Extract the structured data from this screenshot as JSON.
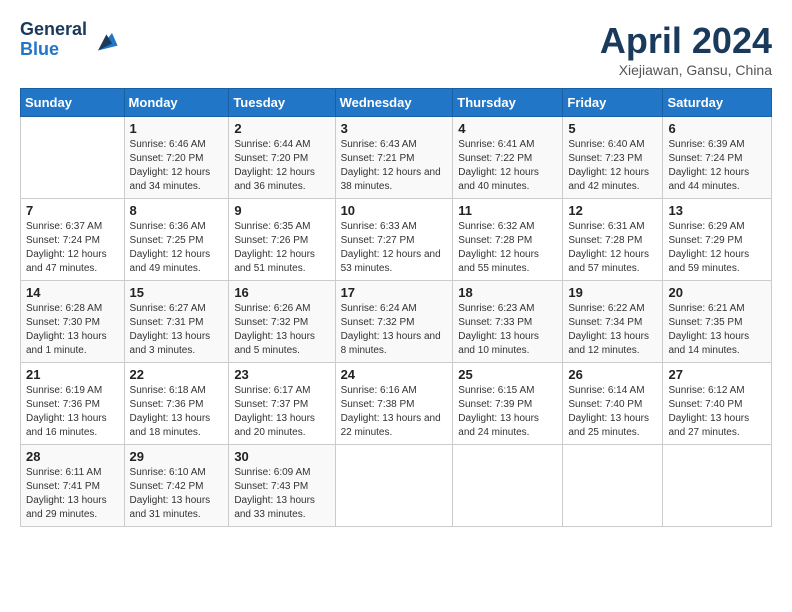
{
  "header": {
    "logo_general": "General",
    "logo_blue": "Blue",
    "title": "April 2024",
    "subtitle": "Xiejiawan, Gansu, China"
  },
  "weekdays": [
    "Sunday",
    "Monday",
    "Tuesday",
    "Wednesday",
    "Thursday",
    "Friday",
    "Saturday"
  ],
  "weeks": [
    [
      {
        "day": "",
        "sunrise": "",
        "sunset": "",
        "daylight": ""
      },
      {
        "day": "1",
        "sunrise": "6:46 AM",
        "sunset": "7:20 PM",
        "daylight": "12 hours and 34 minutes."
      },
      {
        "day": "2",
        "sunrise": "6:44 AM",
        "sunset": "7:20 PM",
        "daylight": "12 hours and 36 minutes."
      },
      {
        "day": "3",
        "sunrise": "6:43 AM",
        "sunset": "7:21 PM",
        "daylight": "12 hours and 38 minutes."
      },
      {
        "day": "4",
        "sunrise": "6:41 AM",
        "sunset": "7:22 PM",
        "daylight": "12 hours and 40 minutes."
      },
      {
        "day": "5",
        "sunrise": "6:40 AM",
        "sunset": "7:23 PM",
        "daylight": "12 hours and 42 minutes."
      },
      {
        "day": "6",
        "sunrise": "6:39 AM",
        "sunset": "7:24 PM",
        "daylight": "12 hours and 44 minutes."
      }
    ],
    [
      {
        "day": "7",
        "sunrise": "6:37 AM",
        "sunset": "7:24 PM",
        "daylight": "12 hours and 47 minutes."
      },
      {
        "day": "8",
        "sunrise": "6:36 AM",
        "sunset": "7:25 PM",
        "daylight": "12 hours and 49 minutes."
      },
      {
        "day": "9",
        "sunrise": "6:35 AM",
        "sunset": "7:26 PM",
        "daylight": "12 hours and 51 minutes."
      },
      {
        "day": "10",
        "sunrise": "6:33 AM",
        "sunset": "7:27 PM",
        "daylight": "12 hours and 53 minutes."
      },
      {
        "day": "11",
        "sunrise": "6:32 AM",
        "sunset": "7:28 PM",
        "daylight": "12 hours and 55 minutes."
      },
      {
        "day": "12",
        "sunrise": "6:31 AM",
        "sunset": "7:28 PM",
        "daylight": "12 hours and 57 minutes."
      },
      {
        "day": "13",
        "sunrise": "6:29 AM",
        "sunset": "7:29 PM",
        "daylight": "12 hours and 59 minutes."
      }
    ],
    [
      {
        "day": "14",
        "sunrise": "6:28 AM",
        "sunset": "7:30 PM",
        "daylight": "13 hours and 1 minute."
      },
      {
        "day": "15",
        "sunrise": "6:27 AM",
        "sunset": "7:31 PM",
        "daylight": "13 hours and 3 minutes."
      },
      {
        "day": "16",
        "sunrise": "6:26 AM",
        "sunset": "7:32 PM",
        "daylight": "13 hours and 5 minutes."
      },
      {
        "day": "17",
        "sunrise": "6:24 AM",
        "sunset": "7:32 PM",
        "daylight": "13 hours and 8 minutes."
      },
      {
        "day": "18",
        "sunrise": "6:23 AM",
        "sunset": "7:33 PM",
        "daylight": "13 hours and 10 minutes."
      },
      {
        "day": "19",
        "sunrise": "6:22 AM",
        "sunset": "7:34 PM",
        "daylight": "13 hours and 12 minutes."
      },
      {
        "day": "20",
        "sunrise": "6:21 AM",
        "sunset": "7:35 PM",
        "daylight": "13 hours and 14 minutes."
      }
    ],
    [
      {
        "day": "21",
        "sunrise": "6:19 AM",
        "sunset": "7:36 PM",
        "daylight": "13 hours and 16 minutes."
      },
      {
        "day": "22",
        "sunrise": "6:18 AM",
        "sunset": "7:36 PM",
        "daylight": "13 hours and 18 minutes."
      },
      {
        "day": "23",
        "sunrise": "6:17 AM",
        "sunset": "7:37 PM",
        "daylight": "13 hours and 20 minutes."
      },
      {
        "day": "24",
        "sunrise": "6:16 AM",
        "sunset": "7:38 PM",
        "daylight": "13 hours and 22 minutes."
      },
      {
        "day": "25",
        "sunrise": "6:15 AM",
        "sunset": "7:39 PM",
        "daylight": "13 hours and 24 minutes."
      },
      {
        "day": "26",
        "sunrise": "6:14 AM",
        "sunset": "7:40 PM",
        "daylight": "13 hours and 25 minutes."
      },
      {
        "day": "27",
        "sunrise": "6:12 AM",
        "sunset": "7:40 PM",
        "daylight": "13 hours and 27 minutes."
      }
    ],
    [
      {
        "day": "28",
        "sunrise": "6:11 AM",
        "sunset": "7:41 PM",
        "daylight": "13 hours and 29 minutes."
      },
      {
        "day": "29",
        "sunrise": "6:10 AM",
        "sunset": "7:42 PM",
        "daylight": "13 hours and 31 minutes."
      },
      {
        "day": "30",
        "sunrise": "6:09 AM",
        "sunset": "7:43 PM",
        "daylight": "13 hours and 33 minutes."
      },
      {
        "day": "",
        "sunrise": "",
        "sunset": "",
        "daylight": ""
      },
      {
        "day": "",
        "sunrise": "",
        "sunset": "",
        "daylight": ""
      },
      {
        "day": "",
        "sunrise": "",
        "sunset": "",
        "daylight": ""
      },
      {
        "day": "",
        "sunrise": "",
        "sunset": "",
        "daylight": ""
      }
    ]
  ]
}
